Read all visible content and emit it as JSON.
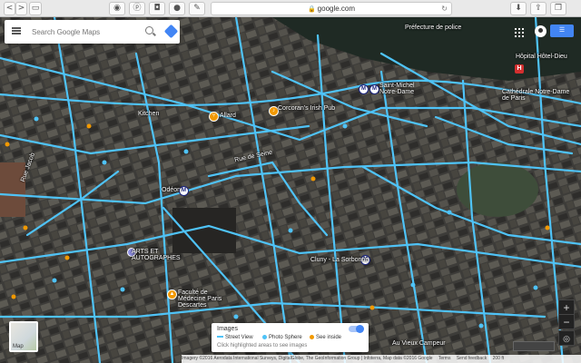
{
  "browser": {
    "url": "google.com",
    "nav_back": "<",
    "nav_forward": ">"
  },
  "search": {
    "placeholder": "Search Google Maps"
  },
  "map_labels": {
    "prefecture": "Préfecture de police",
    "hospital": "Hôpital Hôtel-Dieu",
    "notre_dame": "Cathédrale Notre-Dame de Paris",
    "saint_michel": "Saint-Michel Notre-Dame",
    "corcoran": "Corcoran's Irish Pub",
    "allard": "Allard",
    "kitchen": "Kitchen",
    "odeon": "Odéon",
    "cluny": "Cluny - La Sorbonne",
    "arts": "ARTS ET AUTOGRAPHES",
    "faculte": "Faculté de Médecine Paris Descartes",
    "au_vieux": "Au Vieux Campeur",
    "rue_jacob": "Rue Jacob",
    "rue_seine": "Rue de Seine"
  },
  "images_panel": {
    "title": "Images",
    "street_view": "Street View",
    "photo_sphere": "Photo Sphere",
    "see_inside": "See inside",
    "hint": "Click highlighted areas to see images",
    "enabled": true
  },
  "map_thumb": {
    "label": "Map"
  },
  "controls": {
    "zoom_in": "+",
    "zoom_out": "−"
  },
  "footer": {
    "attribution": "Imagery ©2016 Aerodata International Surveys, DigitalGlobe, The GeoInformation Group | Infoterra, Map data ©2016 Google",
    "terms": "Terms",
    "feedback": "Send feedback",
    "scale": "200 ft"
  },
  "colors": {
    "street_view_line": "#4fc3f7",
    "photo_sphere": "#4fc3f7",
    "see_inside": "#f29900",
    "accent": "#4285f4"
  }
}
